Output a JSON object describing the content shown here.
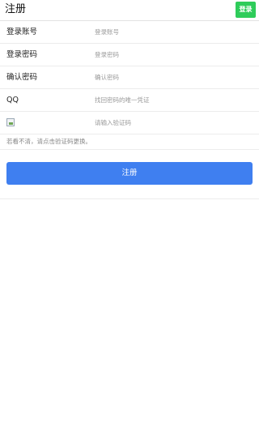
{
  "header": {
    "title": "注册",
    "login_label": "登录"
  },
  "form": {
    "account": {
      "label": "登录账号",
      "placeholder": "登录账号"
    },
    "password": {
      "label": "登录密码",
      "placeholder": "登录密码"
    },
    "confirm": {
      "label": "确认密码",
      "placeholder": "确认密码"
    },
    "qq": {
      "label": "QQ",
      "placeholder": "找回密码的唯一凭证"
    },
    "captcha": {
      "placeholder": "请输入验证码"
    }
  },
  "hint": "若看不清，请点击验证码更换。",
  "submit_label": "注册",
  "colors": {
    "login_button": "#2ecc5a",
    "submit_button": "#3f7ff0"
  },
  "icons": {
    "captcha_image": "broken-image-icon"
  }
}
